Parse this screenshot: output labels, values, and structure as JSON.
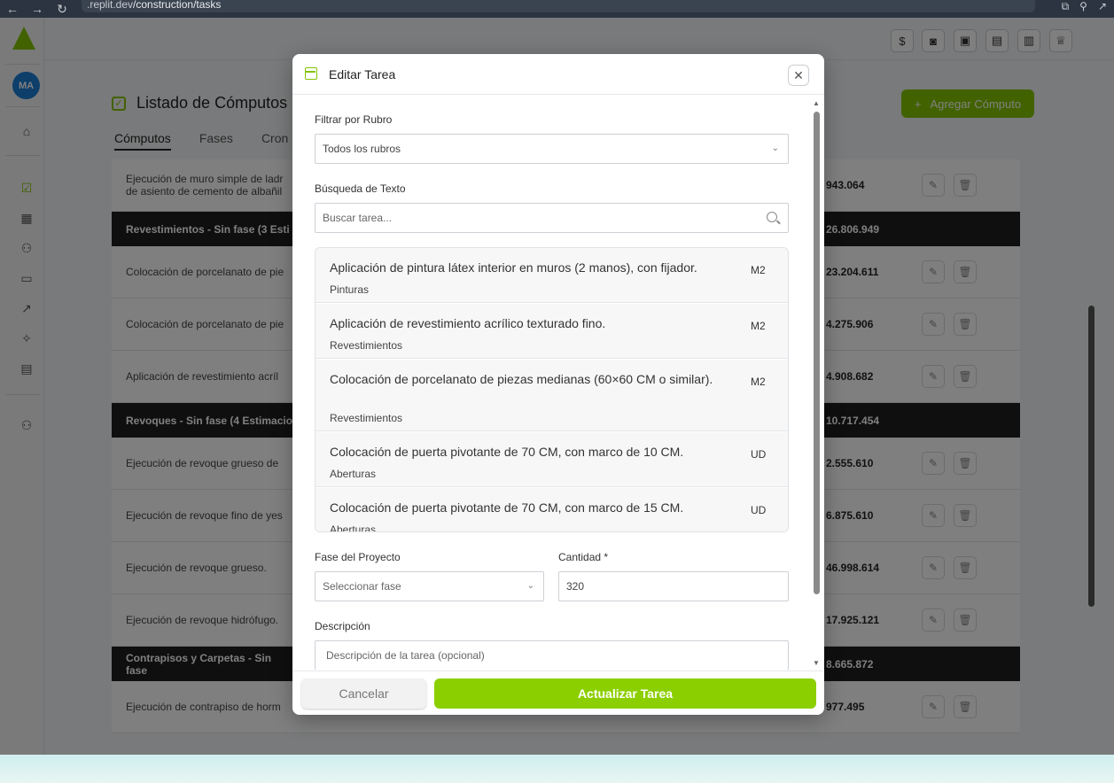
{
  "browser": {
    "url_prefix": ".replit.dev",
    "url_path": "/construction/tasks"
  },
  "sidebar": {
    "avatar_initials": "MA"
  },
  "page": {
    "title": "Listado de Cómputos",
    "add_button": "Agregar Cómputo",
    "tabs": [
      "Cómputos",
      "Fases",
      "Cron"
    ]
  },
  "table_rows": [
    {
      "type": "item",
      "desc": "Ejecución de muro simple de ladr de asiento de cemento de albañil",
      "amount": "943.064"
    },
    {
      "type": "group",
      "desc": "Revestimientos - Sin fase (3 Esti",
      "amount": "26.806.949"
    },
    {
      "type": "item",
      "desc": "Colocación de porcelanato de pie",
      "amount": "23.204.611"
    },
    {
      "type": "item",
      "desc": "Colocación de porcelanato de pie",
      "amount": "4.275.906"
    },
    {
      "type": "item",
      "desc": "Aplicación de revestimiento acríl",
      "amount": "4.908.682"
    },
    {
      "type": "group",
      "desc": "Revoques - Sin fase (4 Estimacio",
      "amount": "10.717.454"
    },
    {
      "type": "item",
      "desc": "Ejecución de revoque grueso de",
      "amount": "2.555.610"
    },
    {
      "type": "item",
      "desc": "Ejecución de revoque fino de yes",
      "amount": "6.875.610"
    },
    {
      "type": "item",
      "desc": "Ejecución de revoque grueso.",
      "amount": "46.998.614"
    },
    {
      "type": "item",
      "desc": "Ejecución de revoque hidrófugo.",
      "amount": "17.925.121"
    },
    {
      "type": "group",
      "desc": "Contrapisos y Carpetas - Sin fase",
      "amount": "8.665.872"
    },
    {
      "type": "item",
      "desc": "Ejecución de contrapiso de horm",
      "amount": "977.495"
    }
  ],
  "modal": {
    "title": "Editar Tarea",
    "filter_label": "Filtrar por Rubro",
    "filter_value": "Todos los rubros",
    "search_label": "Búsqueda de Texto",
    "search_placeholder": "Buscar tarea...",
    "tasks": [
      {
        "name": "Aplicación de pintura látex interior en muros (2 manos), con fijador.",
        "category": "Pinturas",
        "unit": "M2"
      },
      {
        "name": "Aplicación de revestimiento acrílico texturado fino.",
        "category": "Revestimientos",
        "unit": "M2"
      },
      {
        "name": "Colocación de porcelanato de piezas medianas (60×60 CM o similar).",
        "category": "Revestimientos",
        "unit": "M2"
      },
      {
        "name": "Colocación de puerta pivotante de 70 CM, con marco de 10 CM.",
        "category": "Aberturas",
        "unit": "UD"
      },
      {
        "name": "Colocación de puerta pivotante de 70 CM, con marco de 15 CM.",
        "category": "Aberturas",
        "unit": "UD"
      }
    ],
    "phase_label": "Fase del Proyecto",
    "phase_placeholder": "Seleccionar fase",
    "quantity_label": "Cantidad *",
    "quantity_value": "320",
    "description_label": "Descripción",
    "description_placeholder": "Descripción de la tarea (opcional)",
    "cancel_label": "Cancelar",
    "update_label": "Actualizar Tarea"
  },
  "colors": {
    "accent": "#84c400",
    "group_row": "#1f1f1f",
    "avatar": "#1a7fd4"
  }
}
